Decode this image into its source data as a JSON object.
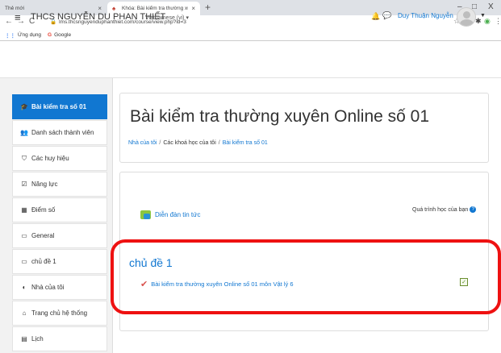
{
  "browser": {
    "tabs": [
      {
        "title": "Thẻ mới"
      },
      {
        "title": "Khóa: Bài kiểm tra thường xuyên"
      }
    ],
    "url": "lms.thcsnguyenduphanthiet.com/course/view.php?id=3",
    "bookmarks": [
      {
        "label": "Ứng dụng",
        "icon": "apps-grid-icon"
      },
      {
        "label": "Google",
        "icon": "google-icon"
      }
    ],
    "window_controls": [
      "–",
      "□",
      "X"
    ]
  },
  "site": {
    "name": "THCS NGUYỄN DU PHAN THIẾT",
    "language": "Vietnamese (vi) ▾",
    "user_name": "Duy Thuận Nguyễn"
  },
  "drawer": {
    "items": [
      {
        "label": "Bài kiểm tra số 01",
        "icon": "graduation-cap-icon",
        "active": true
      },
      {
        "label": "Danh sách thành viên",
        "icon": "users-icon"
      },
      {
        "label": "Các huy hiệu",
        "icon": "shield-icon"
      },
      {
        "label": "Năng lực",
        "icon": "checkbox-icon"
      },
      {
        "label": "Điểm số",
        "icon": "table-icon"
      },
      {
        "label": "General",
        "icon": "folder-icon"
      },
      {
        "label": "chủ đề 1",
        "icon": "folder-icon"
      },
      {
        "label": "Nhà của tôi",
        "icon": "dashboard-icon"
      },
      {
        "label": "Trang chủ hệ thống",
        "icon": "home-icon"
      },
      {
        "label": "Lịch",
        "icon": "calendar-icon"
      }
    ]
  },
  "page": {
    "title": "Bài kiểm tra thường xuyên Online số 01",
    "breadcrumb": [
      "Nhà của tôi",
      "Các khoá học của tôi",
      "Bài kiểm tra số 01"
    ]
  },
  "course": {
    "progress_label": "Quá trình học của bạn",
    "forum_label": "Diễn đàn tin tức",
    "section_title": "chủ đề 1",
    "quiz_label": "Bài kiểm tra thường xuyên Online số 01 môn Vật lý 6",
    "quiz_completed": true
  },
  "colors": {
    "accent": "#1177d1",
    "highlight": "#ee1111"
  }
}
